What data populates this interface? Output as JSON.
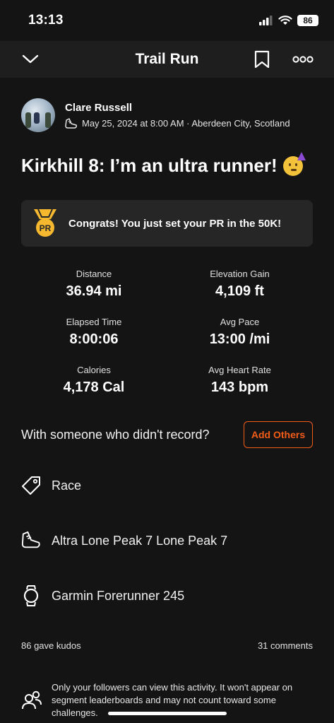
{
  "status_bar": {
    "time": "13:13",
    "battery": "86"
  },
  "nav": {
    "title": "Trail Run"
  },
  "athlete": {
    "name": "Clare Russell",
    "meta": "May 25, 2024 at 8:00 AM · Aberdeen City, Scotland"
  },
  "activity": {
    "title": "Kirkhill 8: I’m an ultra runner!"
  },
  "pr_banner": {
    "text": "Congrats! You just set your PR in the 50K!",
    "badge": "PR",
    "badge_color": "#f5b82e"
  },
  "stats": [
    {
      "label": "Distance",
      "value": "36.94 mi"
    },
    {
      "label": "Elevation Gain",
      "value": "4,109 ft"
    },
    {
      "label": "Elapsed Time",
      "value": "8:00:06"
    },
    {
      "label": "Avg Pace",
      "value": "13:00 /mi"
    },
    {
      "label": "Calories",
      "value": "4,178 Cal"
    },
    {
      "label": "Avg Heart Rate",
      "value": "143 bpm"
    }
  ],
  "with_others": {
    "prompt": "With someone who didn't record?",
    "button": "Add Others",
    "accent": "#f25c19"
  },
  "details": {
    "workout_type": "Race",
    "gear": "Altra Lone Peak 7 Lone Peak 7",
    "device": "Garmin Forerunner 245"
  },
  "social": {
    "kudos": "86 gave kudos",
    "comments": "31 comments"
  },
  "privacy": {
    "text": "Only your followers can view this activity. It won't appear on segment leaderboards and may not count toward some challenges."
  }
}
